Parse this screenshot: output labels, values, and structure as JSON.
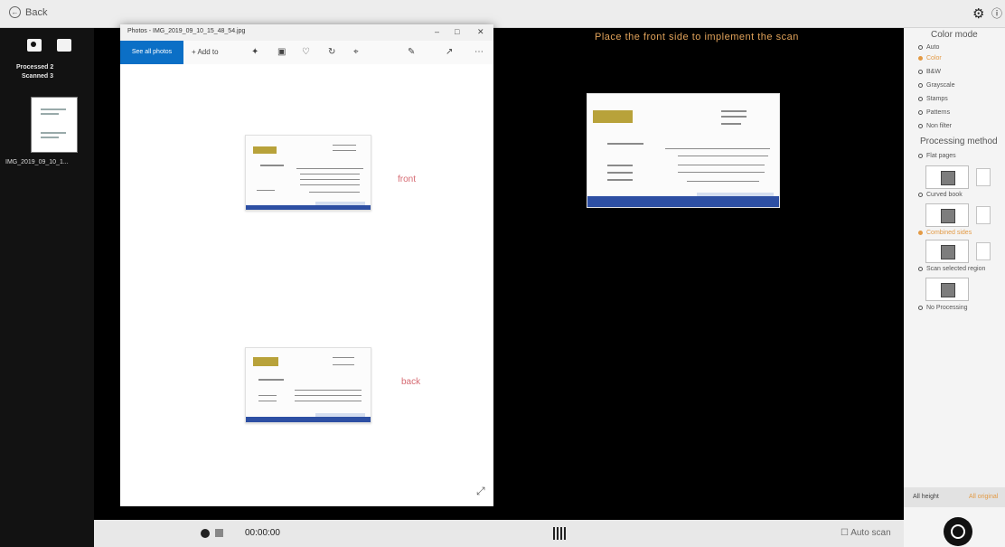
{
  "topbar": {
    "back_label": "Back"
  },
  "sidebar": {
    "processed": "Processed 2",
    "scanned": "Scanned 3",
    "thumb_label": "IMG_2019_09_10_1..."
  },
  "preview": {
    "hint": "Place the front side to implement the scan"
  },
  "photos": {
    "title": "Photos - IMG_2019_09_10_15_48_54.jpg",
    "see_all": "See all photos",
    "add_to": "Add to",
    "front_label": "front",
    "back_label": "back"
  },
  "bottombar": {
    "timer": "00:00:00",
    "auto_scan": "Auto scan"
  },
  "right_panel": {
    "color_mode_header": "Color mode",
    "color_modes": [
      "Auto",
      "Color",
      "B&W",
      "Grayscale",
      "Stamps",
      "Patterns",
      "Non filter"
    ],
    "selected_color_mode": "Color",
    "processing_header": "Processing method",
    "flat_pages": "Flat pages",
    "curved_book": "Curved book",
    "combined_sides": "Combined sides",
    "scan_selected": "Scan selected region",
    "no_processing": "No Processing",
    "selected_processing": "Combined sides",
    "tab_all_height": "All height",
    "tab_all_original": "All original"
  },
  "colors": {
    "accent": "#e39a45",
    "brand_blue": "#0b6fc6",
    "hint": "#e0a25a"
  }
}
